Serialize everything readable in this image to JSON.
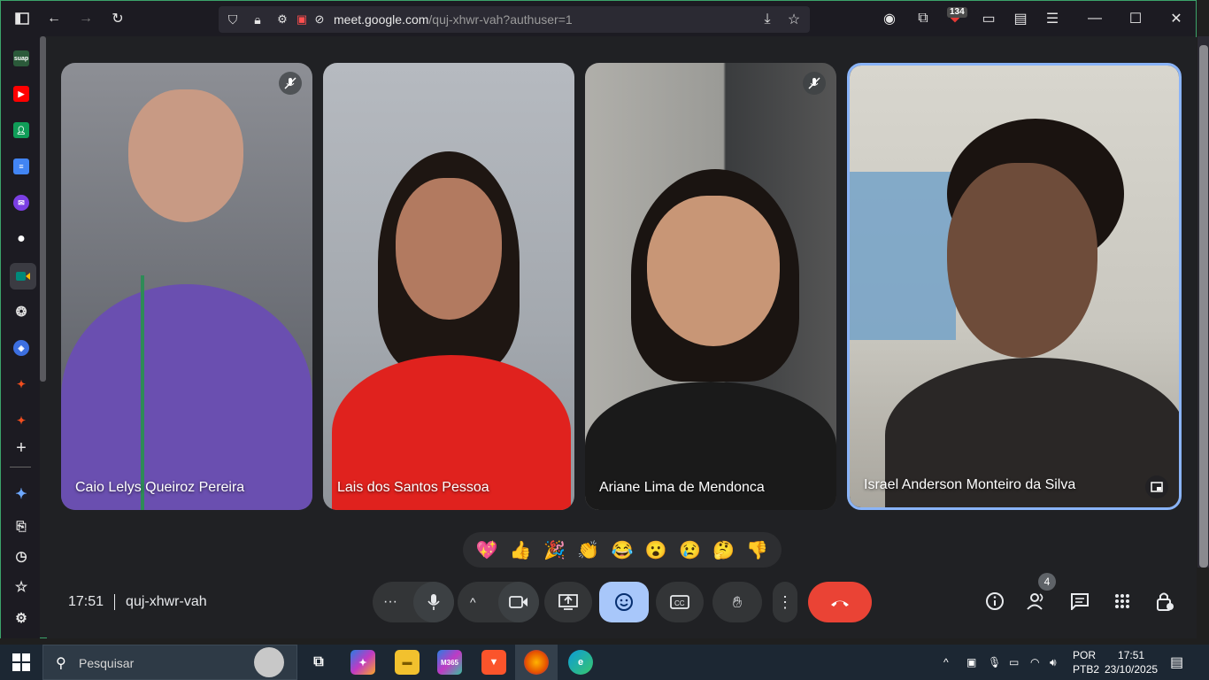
{
  "browser": {
    "url_host": "meet.google.com",
    "url_path": "/quj-xhwr-vah?authuser=1",
    "extension_badge": "134"
  },
  "sidebar": {
    "items": [
      {
        "name": "suap",
        "label": "suap",
        "color": "#2b5a3a"
      },
      {
        "name": "youtube",
        "label": "▶",
        "color": "#ff0000"
      },
      {
        "name": "classroom",
        "label": "",
        "color": "#0f9d58"
      },
      {
        "name": "docs",
        "label": "≡",
        "color": "#4285f4"
      },
      {
        "name": "messenger",
        "label": "",
        "color": "#7b3fe4"
      },
      {
        "name": "github",
        "label": "",
        "color": "#ffffff"
      },
      {
        "name": "meet",
        "label": "",
        "color": "#00897b"
      },
      {
        "name": "chatgpt",
        "label": "",
        "color": "#d0d0d0"
      },
      {
        "name": "app-9",
        "label": "",
        "color": "#3c6fe0"
      },
      {
        "name": "figma-1",
        "label": "",
        "color": "#f24e1e"
      },
      {
        "name": "figma-2",
        "label": "",
        "color": "#f24e1e"
      }
    ]
  },
  "participants": [
    {
      "name": "Caio Lelys Queiroz Pereira",
      "muted": true,
      "bg": "#6c6f78",
      "face": "#c89a84",
      "shirt": "#6a4fb0",
      "hair": "#2a1f1a"
    },
    {
      "name": "Lais dos Santos Pessoa",
      "muted": false,
      "bg": "#a3a8ae",
      "face": "#b27a60",
      "shirt": "#e0221e",
      "hair": "#1e1612"
    },
    {
      "name": "Ariane Lima de Mendonca",
      "muted": true,
      "bg": "#9a9a96",
      "face": "#c89676",
      "shirt": "#1a1a1a",
      "hair": "#1a1411"
    },
    {
      "name": "Israel Anderson Monteiro da Silva",
      "muted": false,
      "bg": "#c9c7bf",
      "face": "#6e4c3a",
      "shirt": "#2a2726",
      "hair": "#1a1310"
    }
  ],
  "reactions": [
    "💖",
    "👍",
    "🎉",
    "👏",
    "😂",
    "😮",
    "😢",
    "🤔",
    "👎"
  ],
  "meeting": {
    "time": "17:51",
    "code": "quj-xhwr-vah",
    "people_count": "4"
  },
  "taskbar": {
    "search_placeholder": "Pesquisar",
    "lang_top": "POR",
    "lang_bottom": "PTB2",
    "time": "17:51",
    "date": "23/10/2025"
  },
  "colors": {
    "accent_blue": "#a8c7fa",
    "end_call_red": "#ea4335",
    "active_border": "#8ab4f8"
  }
}
